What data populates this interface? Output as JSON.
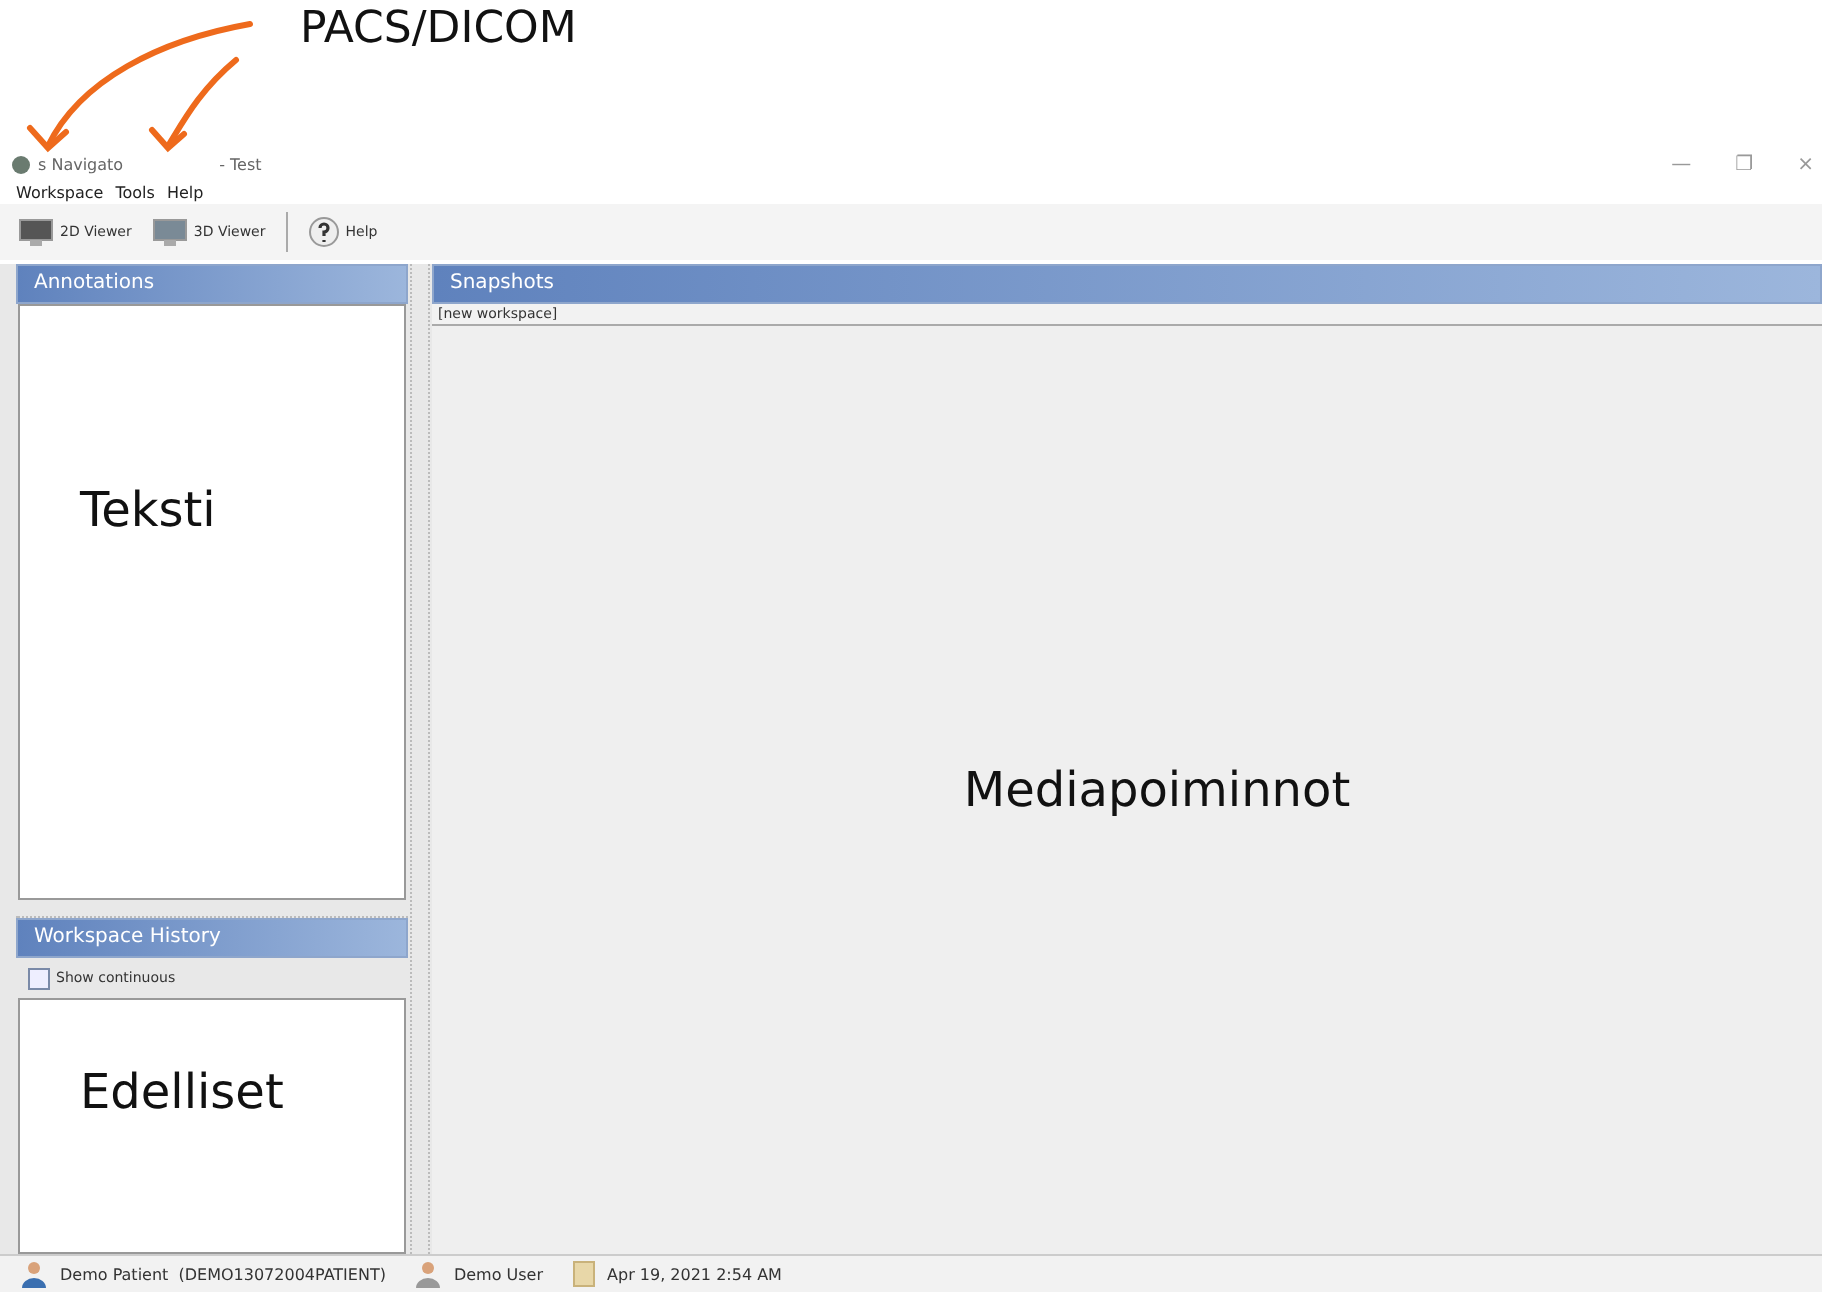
{
  "callout": {
    "heading": "PACS/DICOM"
  },
  "window": {
    "title_fragments": [
      "s Navigato",
      "- Test"
    ],
    "controls": [
      "—",
      "❐",
      "×"
    ]
  },
  "menu": [
    "Workspace",
    "Tools",
    "Help"
  ],
  "toolbar": [
    {
      "label": "2D Viewer",
      "kind": "monitor"
    },
    {
      "label": "3D Viewer",
      "kind": "monitor3d"
    },
    {
      "label": "Help",
      "kind": "help"
    }
  ],
  "annotations": {
    "title": "Annotations",
    "note": "Teksti"
  },
  "history": {
    "title": "Workspace History",
    "checkbox": {
      "label": "Show continuous",
      "checked": false
    },
    "note": "Edelliset"
  },
  "snapshots": {
    "title": "Snapshots",
    "workspace": "[new workspace]",
    "note": "Mediapoiminnot"
  },
  "status_bar": [
    {
      "text": "Demo Patient  (DEMO13072004PATIENT)",
      "kind": "patient"
    },
    {
      "text": "Demo User",
      "kind": "user"
    },
    {
      "text": "Apr 19, 2021 2:54 AM",
      "kind": "date"
    }
  ]
}
